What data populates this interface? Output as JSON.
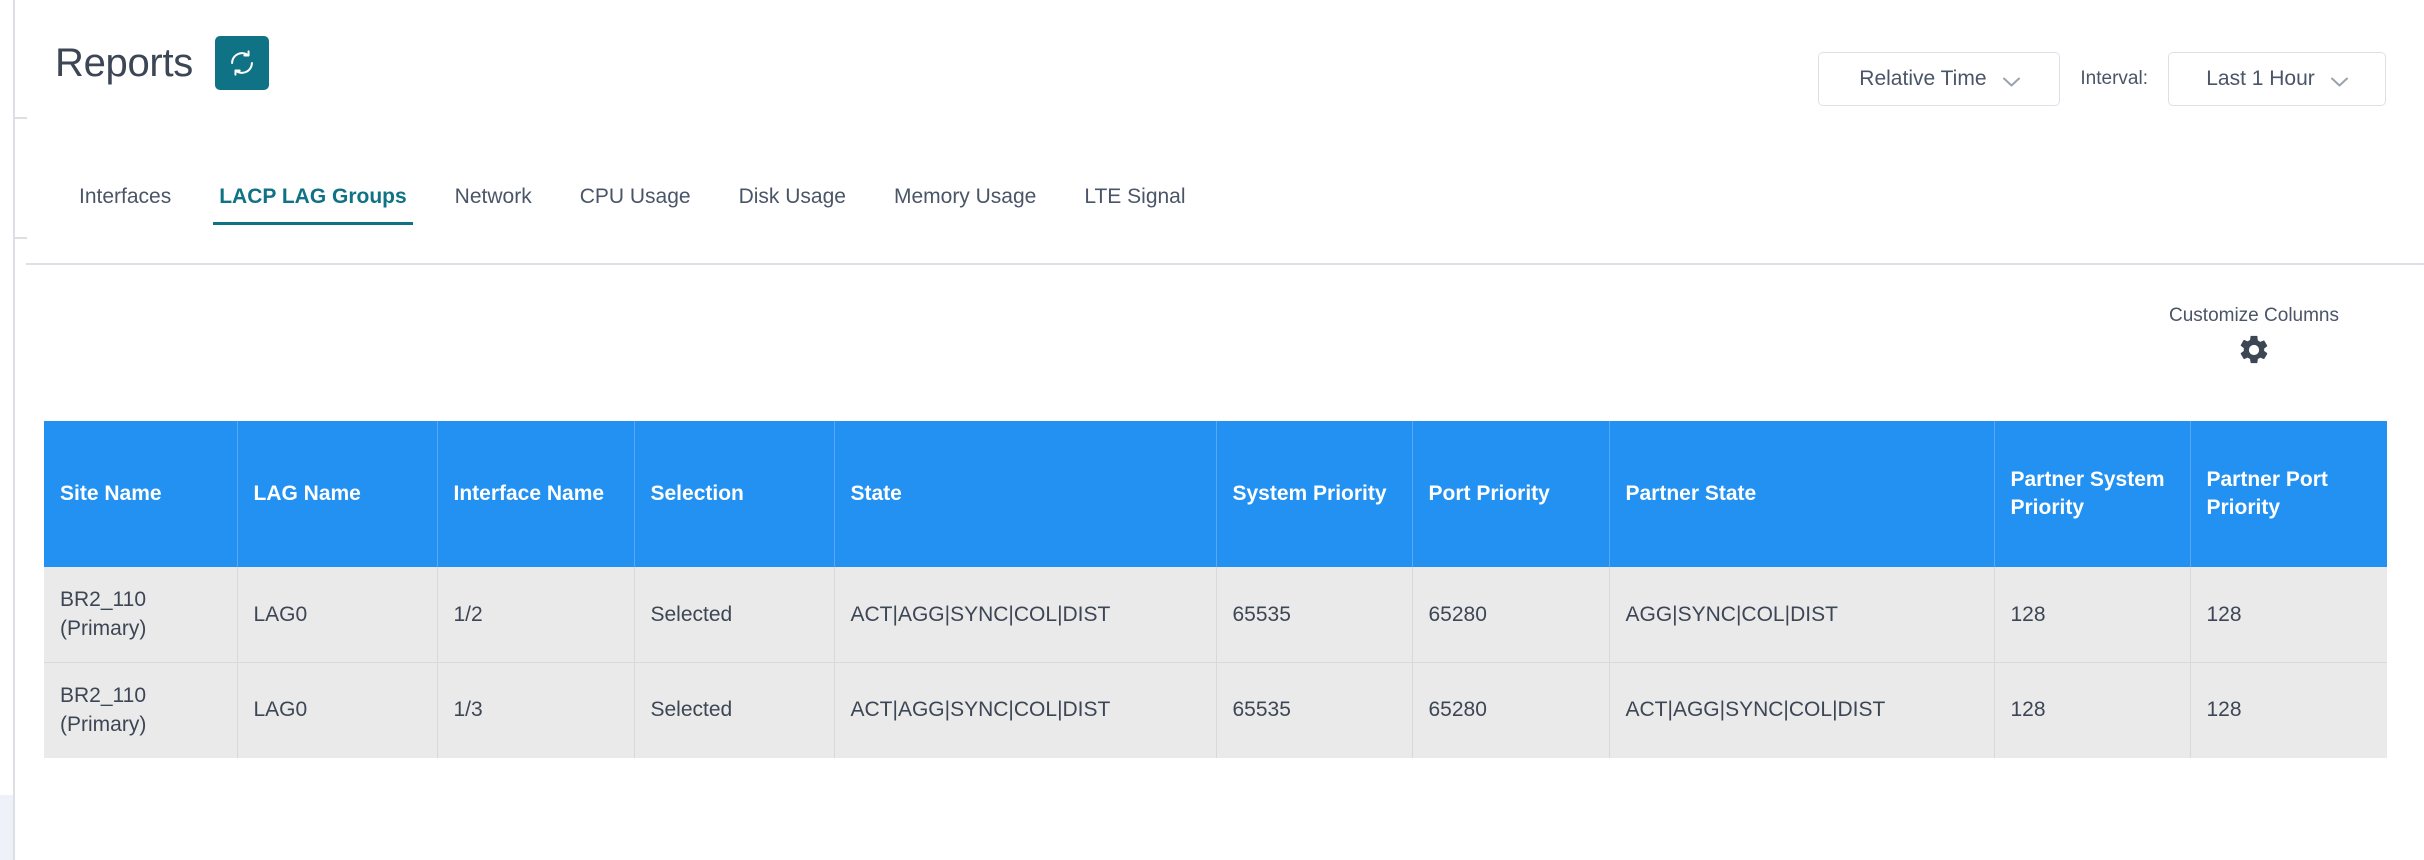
{
  "header": {
    "title": "Reports",
    "refresh_icon": "refresh-icon",
    "time_mode": {
      "label": "Relative Time",
      "chevron_icon": "chevron-down-icon"
    },
    "interval_label": "Interval:",
    "interval": {
      "label": "Last 1 Hour",
      "chevron_icon": "chevron-down-icon"
    }
  },
  "tabs": [
    {
      "label": "Interfaces",
      "active": false
    },
    {
      "label": "LACP LAG Groups",
      "active": true
    },
    {
      "label": "Network",
      "active": false
    },
    {
      "label": "CPU Usage",
      "active": false
    },
    {
      "label": "Disk Usage",
      "active": false
    },
    {
      "label": "Memory Usage",
      "active": false
    },
    {
      "label": "LTE Signal",
      "active": false
    }
  ],
  "toolbar": {
    "customize_columns_label": "Customize Columns",
    "gear_icon": "gear-icon"
  },
  "table": {
    "columns": [
      "Site Name",
      "LAG Name",
      "Interface Name",
      "Selection",
      "State",
      "System Priority",
      "Port Priority",
      "Partner State",
      "Partner System Priority",
      "Partner Port Priority"
    ],
    "rows": [
      {
        "site_name": "BR2_110\n(Primary)",
        "lag_name": "LAG0",
        "interface_name": "1/2",
        "selection": "Selected",
        "state": "ACT|AGG|SYNC|COL|DIST",
        "system_priority": "65535",
        "port_priority": "65280",
        "partner_state": "AGG|SYNC|COL|DIST",
        "partner_system_priority": "128",
        "partner_port_priority": "128"
      },
      {
        "site_name": "BR2_110\n(Primary)",
        "lag_name": "LAG0",
        "interface_name": "1/3",
        "selection": "Selected",
        "state": "ACT|AGG|SYNC|COL|DIST",
        "system_priority": "65535",
        "port_priority": "65280",
        "partner_state": "ACT|AGG|SYNC|COL|DIST",
        "partner_system_priority": "128",
        "partner_port_priority": "128"
      }
    ]
  },
  "colors": {
    "accent_teal": "#0f7285",
    "table_header_blue": "#2291f2",
    "row_background": "#eaeaea",
    "text": "#3d4655"
  }
}
